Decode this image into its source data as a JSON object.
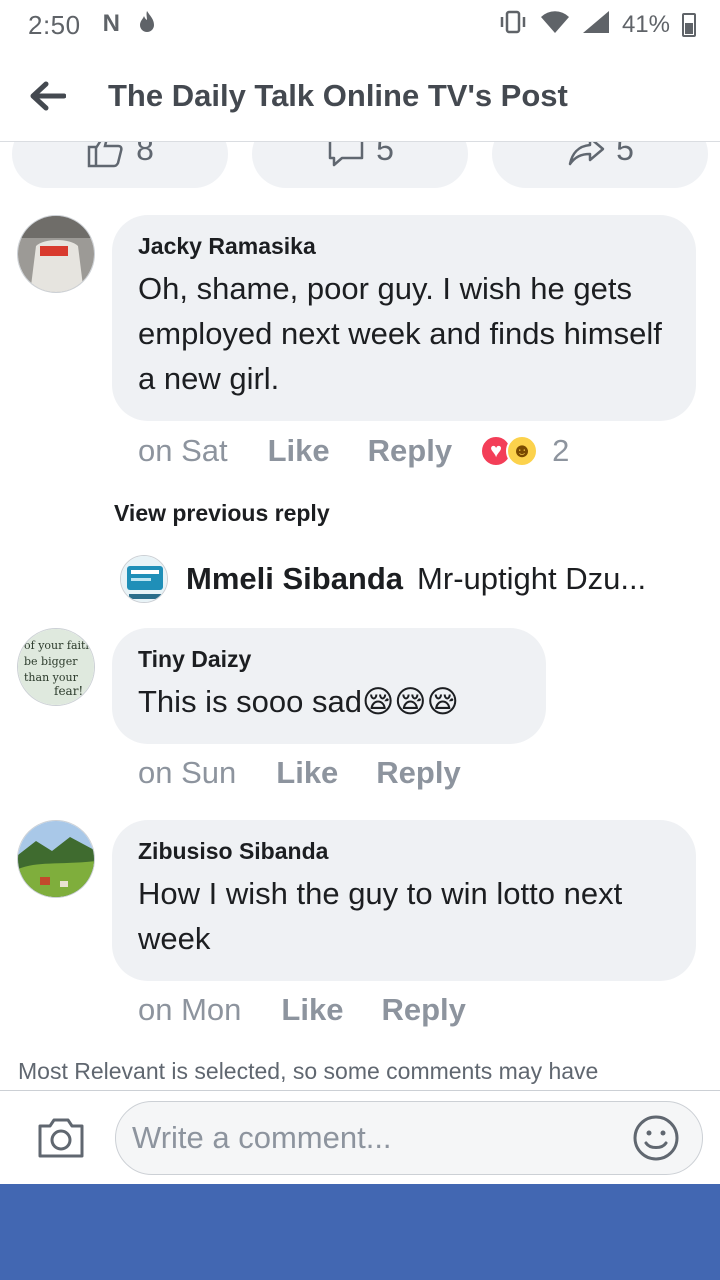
{
  "status_bar": {
    "time": "2:50",
    "battery": "41%",
    "left_icons": [
      "n-icon",
      "flame-icon"
    ],
    "right_icons": [
      "vibrate-icon",
      "wifi-icon",
      "signal-icon",
      "battery-icon"
    ]
  },
  "header": {
    "title": "The Daily Talk Online TV's Post"
  },
  "reaction_bar": {
    "likes": "8",
    "comments": "5",
    "shares": "5"
  },
  "comments": [
    {
      "author": "Jacky Ramasika",
      "text": "Oh, shame, poor guy. I wish he gets employed next week and finds himself a new girl.",
      "time": "on Sat",
      "like_label": "Like",
      "reply_label": "Reply",
      "reaction_count": "2",
      "reactions": [
        "love",
        "haha"
      ]
    },
    {
      "author": "Tiny Daizy",
      "text": "This is sooo sad😪😪😪",
      "time": "on Sun",
      "like_label": "Like",
      "reply_label": "Reply"
    },
    {
      "author": "Zibusiso Sibanda",
      "text": "How I wish the guy to win lotto next week",
      "time": "on Mon",
      "like_label": "Like",
      "reply_label": "Reply"
    }
  ],
  "thread": {
    "view_previous": "View previous reply",
    "reply_author": "Mmeli Sibanda",
    "reply_preview": "Mr-uptight Dzu..."
  },
  "notice": "Most Relevant is selected, so some comments may have",
  "composer": {
    "placeholder": "Write a comment..."
  },
  "colors": {
    "bubble": "#eff1f4",
    "nav_bar": "#4267b2",
    "muted_text": "#8d949e",
    "love": "#f33e58",
    "haha": "#fcd24c"
  }
}
